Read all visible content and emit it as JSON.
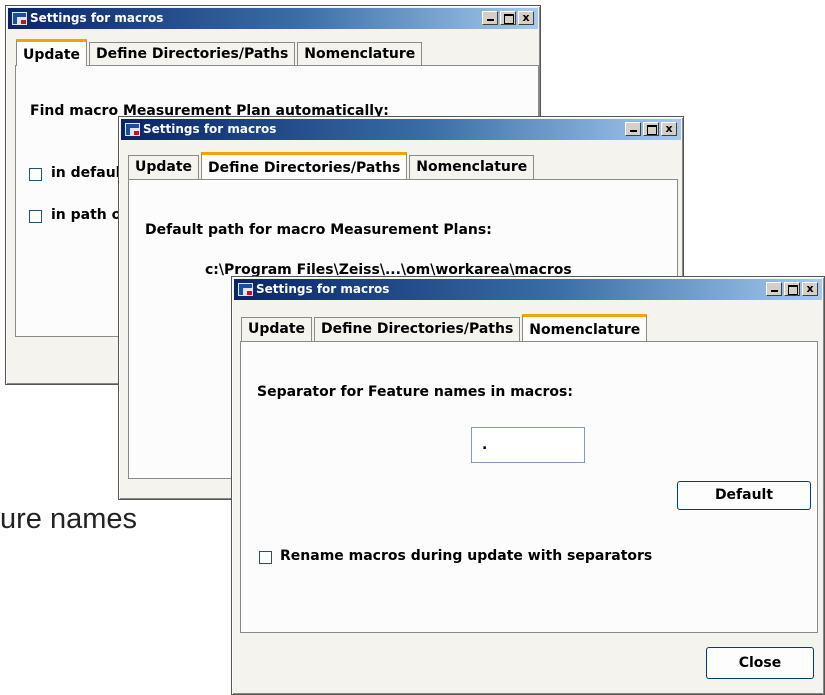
{
  "background_caption": "ure names",
  "window_title": "Settings for macros",
  "window_buttons": {
    "minimize": "_",
    "maximize": "□",
    "close": "x"
  },
  "tabs": [
    "Update",
    "Define Directories/Paths",
    "Nomenclature"
  ],
  "win1": {
    "heading": "Find macro Measurement Plan automatically:",
    "options": [
      "in default path",
      "in path of Measurement Plan"
    ]
  },
  "win2": {
    "heading": "Default path for macro Measurement Plans:",
    "path": "c:\\Program Files\\Zeiss\\...\\om\\workarea\\macros"
  },
  "win3": {
    "separator_label": "Separator for Feature names in macros:",
    "separator_value": ".",
    "default_button": "Default",
    "rename_label": "Rename macros during update with separators",
    "rename_checked": false,
    "close_button": "Close"
  },
  "colors": {
    "active_tab_accent": "#f4a300",
    "titlebar_start": "#0a246a",
    "titlebar_end": "#a6caf0"
  }
}
